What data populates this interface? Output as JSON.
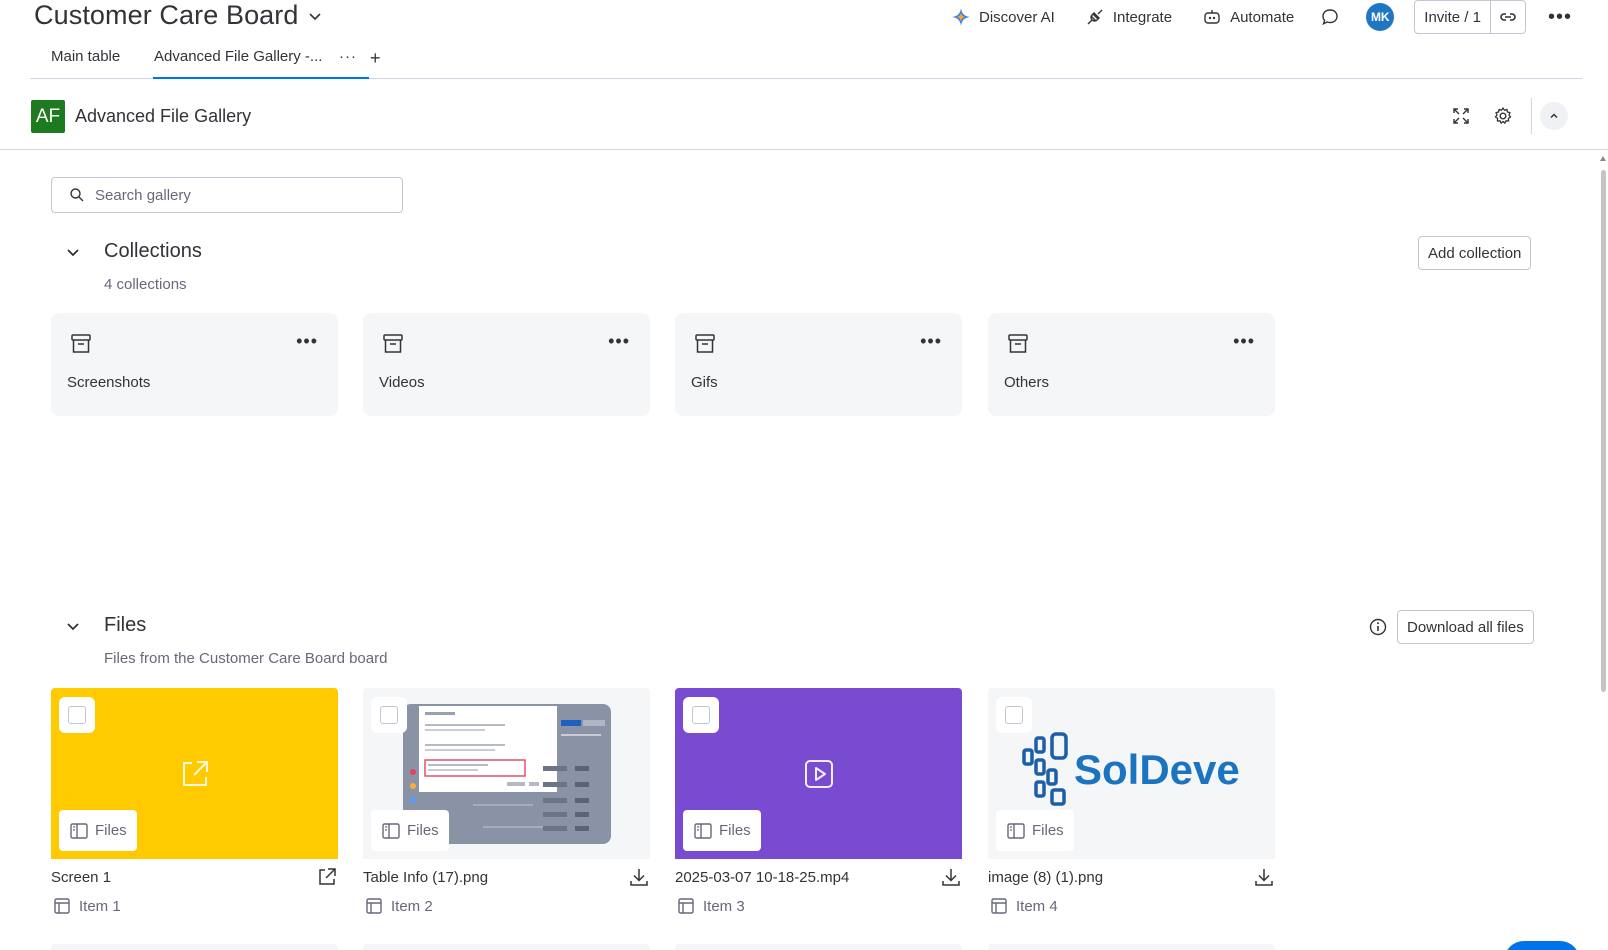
{
  "board": {
    "title": "Customer Care Board"
  },
  "top_actions": {
    "discover_ai": "Discover AI",
    "integrate": "Integrate",
    "automate": "Automate",
    "avatar_initials": "MK",
    "invite": "Invite / 1"
  },
  "tabs": {
    "main": "Main table",
    "active": "Advanced File Gallery -...",
    "more": "···",
    "add": "+"
  },
  "app": {
    "logo": "AF",
    "name": "Advanced File Gallery",
    "logo_color": "#1e7a1e"
  },
  "search": {
    "placeholder": "Search gallery",
    "value": ""
  },
  "collections": {
    "title": "Collections",
    "count_label": "4 collections",
    "add_button": "Add collection",
    "items": [
      {
        "name": "Screenshots",
        "icon": "archive-box-icon"
      },
      {
        "name": "Videos",
        "icon": "archive-box-icon"
      },
      {
        "name": "Gifs",
        "icon": "archive-box-icon"
      },
      {
        "name": "Others",
        "icon": "archive-box-icon"
      }
    ]
  },
  "files": {
    "title": "Files",
    "subtitle": "Files from the Customer Care Board board",
    "download_all": "Download all files",
    "tag_label": "Files",
    "items": [
      {
        "name": "Screen 1",
        "item": "Item 1",
        "thumb": "link",
        "thumb_color": "#ffcb00",
        "action": "open-external-icon"
      },
      {
        "name": "Table Info (17).png",
        "item": "Item 2",
        "thumb": "screenshot",
        "thumb_color": "#f5f6f8",
        "action": "download-icon"
      },
      {
        "name": "2025-03-07 10-18-25.mp4",
        "item": "Item 3",
        "thumb": "video",
        "thumb_color": "#784bd1",
        "action": "download-icon"
      },
      {
        "name": "image (8) (1).png",
        "item": "Item 4",
        "thumb": "logo",
        "thumb_color": "#f5f6f8",
        "action": "download-icon",
        "logo_text": "SolDevelo"
      }
    ]
  },
  "colors": {
    "accent": "#0073ea",
    "text": "#323338",
    "muted": "#676879",
    "card_bg": "#f5f6f8",
    "avatar": "#1f76c2"
  }
}
